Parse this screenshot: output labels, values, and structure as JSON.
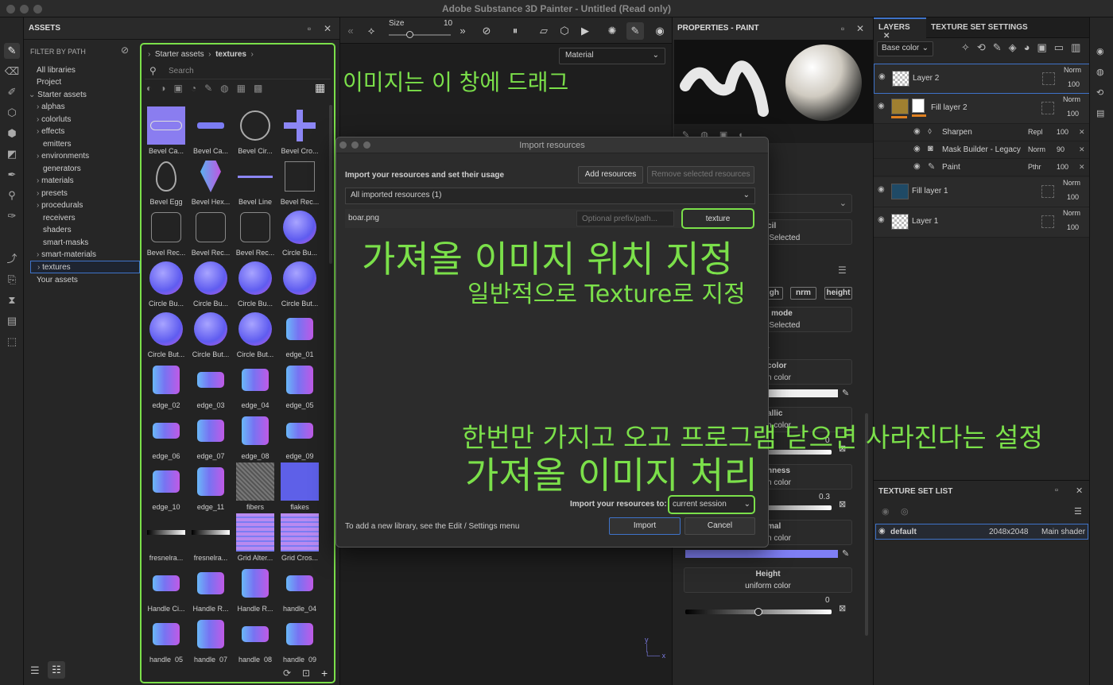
{
  "window": {
    "title": "Adobe Substance 3D Painter - Untitled (Read only)"
  },
  "assets": {
    "title": "ASSETS",
    "filter_label": "FILTER BY PATH",
    "tree": [
      "All libraries",
      "Project",
      "Starter assets",
      "alphas",
      "colorluts",
      "effects",
      "emitters",
      "environments",
      "generators",
      "materials",
      "presets",
      "procedurals",
      "receivers",
      "shaders",
      "smart-masks",
      "smart-materials",
      "textures",
      "Your assets"
    ],
    "breadcrumb": [
      "Starter assets",
      "textures"
    ],
    "search_placeholder": "Search",
    "tiles": [
      "Bevel Ca...",
      "Bevel Ca...",
      "Bevel Cir...",
      "Bevel Cro...",
      "Bevel Egg",
      "Bevel Hex...",
      "Bevel Line",
      "Bevel Rec...",
      "Bevel Rec...",
      "Bevel Rec...",
      "Bevel Rec...",
      "Circle Bu...",
      "Circle Bu...",
      "Circle Bu...",
      "Circle Bu...",
      "Circle But...",
      "Circle But...",
      "Circle But...",
      "Circle But...",
      "edge_01",
      "edge_02",
      "edge_03",
      "edge_04",
      "edge_05",
      "edge_06",
      "edge_07",
      "edge_08",
      "edge_09",
      "edge_10",
      "edge_11",
      "fibers",
      "flakes",
      "fresnelra...",
      "fresnelra...",
      "Grid Alter...",
      "Grid Cros...",
      "Handle Ci...",
      "Handle R...",
      "Handle R...",
      "handle_04",
      "handle_05",
      "handle_07",
      "handle_08",
      "handle_09"
    ]
  },
  "viewport": {
    "size_label": "Size",
    "size_value": "10",
    "material_select": "Material"
  },
  "properties": {
    "title": "PROPERTIES - PAINT",
    "channels": [
      "gh",
      "nrm",
      "height"
    ],
    "cards": [
      {
        "t1": "ncil",
        "t2": "e Selected"
      },
      {
        "t1": "al mode",
        "t2": "e Selected"
      },
      {
        "t1": "color",
        "t2": "n color"
      },
      {
        "t1": "allic",
        "t2": "n color"
      },
      {
        "t1": "hness",
        "t2": "n color"
      },
      {
        "t1": "mal",
        "t2": "n color"
      }
    ],
    "color_label": "lor",
    "metallic_value": "0",
    "roughness_value": "0.3",
    "height_title": "Height",
    "height_sub": "uniform color",
    "height_value": "0"
  },
  "layers": {
    "tab_layers": "LAYERS",
    "tab_texture": "TEXTURE SET SETTINGS",
    "channel_select": "Base color",
    "rows": [
      {
        "name": "Layer 2",
        "blend": "Norm",
        "opacity": "100"
      },
      {
        "name": "Fill layer 2",
        "blend": "Norm",
        "opacity": "100"
      },
      {
        "name": "Sharpen",
        "blend": "Repl",
        "opacity": "100"
      },
      {
        "name": "Mask Builder - Legacy",
        "blend": "Norm",
        "opacity": "90"
      },
      {
        "name": "Paint",
        "blend": "Pthr",
        "opacity": "100"
      },
      {
        "name": "Fill layer 1",
        "blend": "Norm",
        "opacity": "100"
      },
      {
        "name": "Layer 1",
        "blend": "Norm",
        "opacity": "100"
      }
    ]
  },
  "texture_set_list": {
    "title": "TEXTURE SET LIST",
    "name": "default",
    "size": "2048x2048",
    "shader": "Main shader"
  },
  "dialog": {
    "title": "Import resources",
    "subtitle": "Import your resources and set their usage",
    "add_button": "Add resources",
    "remove_button": "Remove selected resources",
    "filter_select": "All imported resources (1)",
    "file_name": "boar.png",
    "prefix_placeholder": "Optional prefix/path...",
    "usage_button": "texture",
    "import_to_label": "Import your resources to:",
    "import_to_value": "current session",
    "footer_note": "To add a new library, see the Edit / Settings menu",
    "import_button": "Import",
    "cancel_button": "Cancel"
  },
  "annotations": {
    "drag": "이미지는 이 창에 드래그",
    "location": "가져올 이미지 위치 지정",
    "location_sub": "일반적으로 Texture로 지정",
    "session_note": "한번만 가지고 오고 프로그램 닫으면 사라진다는 설정",
    "process": "가져올 이미지 처리"
  },
  "colors": {
    "accent_green": "#7be04a",
    "selection_blue": "#3f73c9"
  }
}
